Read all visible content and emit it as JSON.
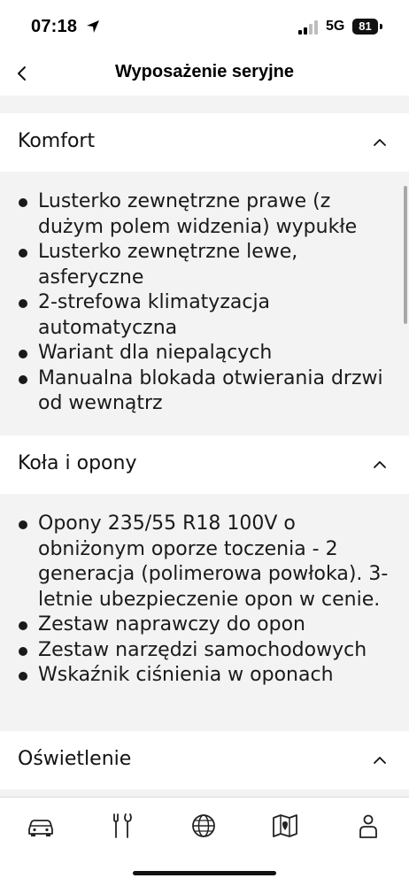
{
  "status_bar": {
    "time": "07:18",
    "network": "5G",
    "battery": "81"
  },
  "header": {
    "title": "Wyposażenie seryjne"
  },
  "icons": {
    "back": "chevron-left-icon",
    "collapse": "chevron-up-icon",
    "tabs": [
      "car-icon",
      "tools-icon",
      "globe-icon",
      "map-icon",
      "person-icon"
    ]
  },
  "sections": [
    {
      "title": "Komfort",
      "items": [
        "Lusterko zewnętrzne prawe (z dużym polem widzenia) wypukłe",
        "Lusterko zewnętrzne lewe, asferyczne",
        "2-strefowa klimatyzacja automatyczna",
        "Wariant dla niepalących",
        "Manualna blokada otwierania drzwi od wewnątrz"
      ]
    },
    {
      "title": "Koła i opony",
      "items": [
        "Opony 235/55 R18 100V o obniżonym oporze toczenia - 2 generacja (polimerowa powłoka). 3-letnie ubezpieczenie opon w cenie.",
        "Zestaw naprawczy do opon",
        "Zestaw narzędzi samochodowych",
        "Wskaźnik ciśnienia w oponach"
      ]
    },
    {
      "title": "Oświetlenie",
      "items": []
    }
  ],
  "colors": {
    "background": "#ffffff",
    "band": "#f3f3f3",
    "text": "#1a1a1a"
  }
}
